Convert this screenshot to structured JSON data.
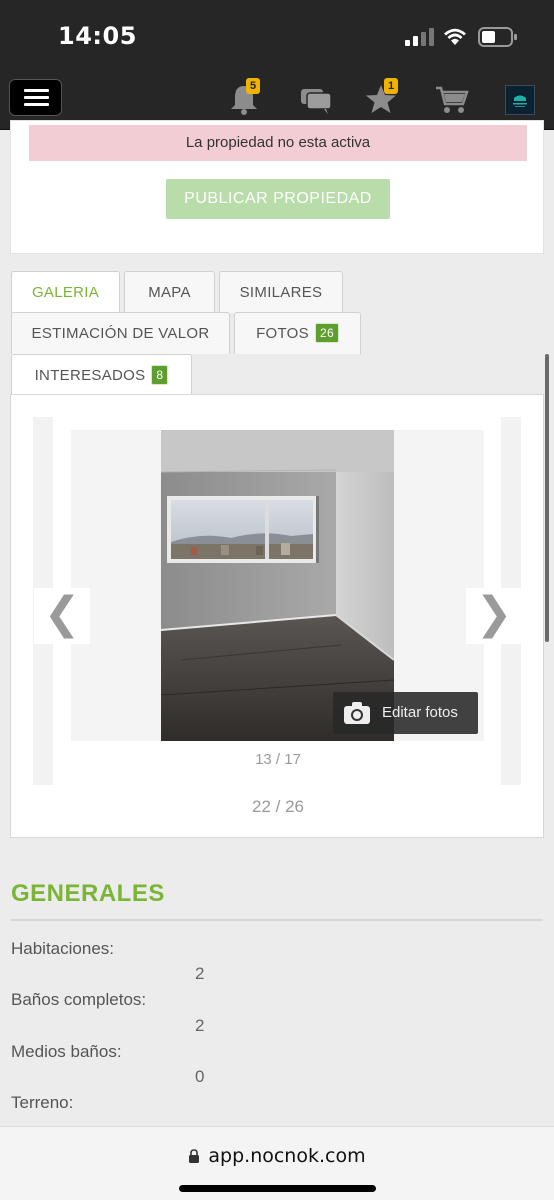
{
  "status_bar": {
    "time": "14:05"
  },
  "header": {
    "notifications_count": "5",
    "favorites_count": "1",
    "icons": [
      "menu-icon",
      "bell-icon",
      "chat-icon",
      "star-icon",
      "cart-icon",
      "avatar"
    ]
  },
  "property_status": {
    "alert_text": "La propiedad no esta activa",
    "publish_label": "PUBLICAR PROPIEDAD"
  },
  "tabs": [
    {
      "label": "GALERIA",
      "active": true
    },
    {
      "label": "MAPA"
    },
    {
      "label": "SIMILARES"
    },
    {
      "label": "ESTIMACIÓN DE VALOR"
    },
    {
      "label": "FOTOS",
      "count": "26"
    },
    {
      "label": "INTERESADOS",
      "count": "8"
    }
  ],
  "gallery": {
    "prev_label": "❮",
    "next_label": "❯",
    "edit_label": "Editar fotos",
    "inner_counter": "13 / 17",
    "outer_counter": "22 / 26"
  },
  "generales": {
    "title": "GENERALES",
    "rows": [
      {
        "label": "Habitaciones:",
        "value": "2"
      },
      {
        "label": "Baños completos:",
        "value": "2"
      },
      {
        "label": "Medios baños:",
        "value": "0"
      },
      {
        "label": "Terreno:",
        "value": ""
      }
    ]
  },
  "browser": {
    "url": "app.nocnok.com"
  },
  "colors": {
    "accent": "#7bb536",
    "badge": "#f0b400",
    "alert_bg": "#f2cdd3",
    "dark": "#262626"
  }
}
